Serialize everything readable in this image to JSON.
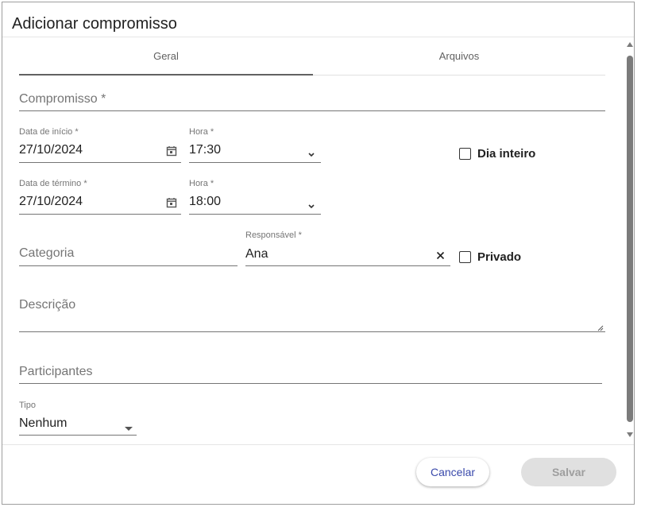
{
  "dialog": {
    "title": "Adicionar compromisso",
    "tabs": [
      {
        "label": "Geral",
        "active": true
      },
      {
        "label": "Arquivos",
        "active": false
      }
    ]
  },
  "form": {
    "compromisso": {
      "placeholder": "Compromisso *",
      "value": ""
    },
    "data_inicio": {
      "label": "Data de início *",
      "value": "27/10/2024"
    },
    "hora_inicio": {
      "label": "Hora *",
      "value": "17:30"
    },
    "dia_inteiro": {
      "label": "Dia inteiro",
      "checked": false
    },
    "data_termino": {
      "label": "Data de término *",
      "value": "27/10/2024"
    },
    "hora_termino": {
      "label": "Hora *",
      "value": "18:00"
    },
    "categoria": {
      "placeholder": "Categoria",
      "value": ""
    },
    "responsavel": {
      "label": "Responsável *",
      "value": "Ana"
    },
    "privado": {
      "label": "Privado",
      "checked": false
    },
    "descricao": {
      "placeholder": "Descrição",
      "value": ""
    },
    "participantes": {
      "placeholder": "Participantes",
      "value": ""
    },
    "tipo": {
      "label": "Tipo",
      "value": "Nenhum"
    }
  },
  "footer": {
    "cancel_label": "Cancelar",
    "save_label": "Salvar"
  },
  "icons": {
    "calendar": "calendar-icon",
    "chevron": "chevron-down-icon",
    "clear": "close-icon",
    "dropdown": "caret-down-icon"
  },
  "colors": {
    "accent": "#3949ab",
    "disabled_bg": "#e0e0e0",
    "disabled_text": "#9e9e9e"
  }
}
